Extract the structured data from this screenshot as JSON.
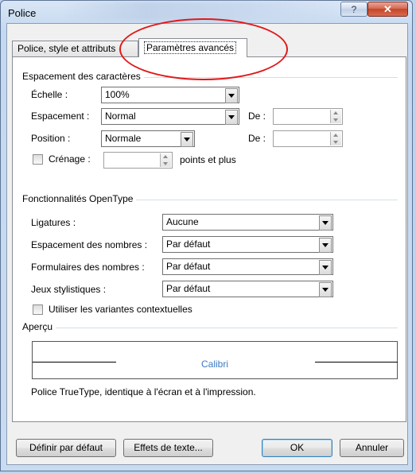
{
  "window": {
    "title": "Police",
    "help_glyph": "?",
    "close_glyph": "✕"
  },
  "tabs": [
    {
      "label": "Police, style et attributs",
      "selected": false
    },
    {
      "label": "Paramètres avancés",
      "selected": true
    }
  ],
  "spacing_section": {
    "title": "Espacement des caractères",
    "scale_label": "Échelle :",
    "scale_value": "100%",
    "spacing_label": "Espacement :",
    "spacing_value": "Normal",
    "spacing_de_label": "De :",
    "spacing_de_value": "",
    "position_label": "Position :",
    "position_value": "Normale",
    "position_de_label": "De :",
    "position_de_value": "",
    "kerning_label": "Crénage :",
    "kerning_value": "",
    "kerning_suffix": "points et plus",
    "kerning_checked": false
  },
  "opentype_section": {
    "title": "Fonctionnalités OpenType",
    "ligatures_label": "Ligatures :",
    "ligatures_value": "Aucune",
    "number_spacing_label": "Espacement des nombres :",
    "number_spacing_value": "Par défaut",
    "number_forms_label": "Formulaires des nombres :",
    "number_forms_value": "Par défaut",
    "stylistic_sets_label": "Jeux stylistiques :",
    "stylistic_sets_value": "Par défaut",
    "contextual_label": "Utiliser les variantes contextuelles",
    "contextual_checked": false
  },
  "preview": {
    "title": "Aperçu",
    "sample_text": "Calibri",
    "description": "Police TrueType, identique à l'écran et à l'impression."
  },
  "buttons": {
    "set_default": "Définir par défaut",
    "text_effects": "Effets de texte...",
    "ok": "OK",
    "cancel": "Annuler"
  },
  "colors": {
    "annotation_red": "#e0191a",
    "preview_text": "#3c79c4"
  }
}
